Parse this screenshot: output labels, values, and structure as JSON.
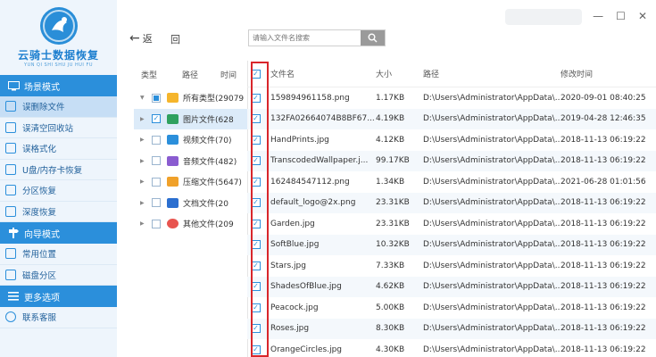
{
  "app": {
    "name": "云骑士数据恢复",
    "subtitle": "YUN QI SHI SHU JU HUI FU"
  },
  "sidebar": {
    "sections": [
      {
        "title": "场景模式",
        "items": [
          "误删除文件",
          "误清空回收站",
          "误格式化",
          "U盘/内存卡恢复",
          "分区恢复",
          "深度恢复"
        ]
      },
      {
        "title": "向导模式",
        "items": [
          "常用位置",
          "磁盘分区"
        ]
      },
      {
        "title": "更多选项",
        "items": [
          "联系客服"
        ]
      }
    ]
  },
  "toolbar": {
    "back_label": "返",
    "forward_label": "回",
    "search_placeholder": "请输入文件名搜索"
  },
  "tree": {
    "headers": [
      "类型",
      "路径",
      "时间"
    ],
    "items": [
      {
        "label": "所有类型(29079",
        "color": "#f5b52c"
      },
      {
        "label": "图片文件(628",
        "color": "#2fa15f"
      },
      {
        "label": "视频文件(70)",
        "color": "#2b8fdb"
      },
      {
        "label": "音频文件(482)",
        "color": "#8a5cd0"
      },
      {
        "label": "压缩文件(5647)",
        "color": "#f0a12a"
      },
      {
        "label": "文档文件(20",
        "color": "#2b6fd0"
      },
      {
        "label": "其他文件(209",
        "color": "#e8544f"
      }
    ]
  },
  "table": {
    "headers": [
      "文件名",
      "大小",
      "路径",
      "修改时间"
    ],
    "rows": [
      [
        "159894961158.png",
        "1.17KB",
        "D:\\Users\\Administrator\\AppData\\...",
        "2020-09-01 08:40:25"
      ],
      [
        "132FA02664074B8BF67...",
        "4.19KB",
        "D:\\Users\\Administrator\\AppData\\...",
        "2019-04-28 12:46:35"
      ],
      [
        "HandPrints.jpg",
        "4.12KB",
        "D:\\Users\\Administrator\\AppData\\...",
        "2018-11-13 06:19:22"
      ],
      [
        "TranscodedWallpaper.j...",
        "99.17KB",
        "D:\\Users\\Administrator\\AppData\\...",
        "2018-11-13 06:19:22"
      ],
      [
        "162484547112.png",
        "1.34KB",
        "D:\\Users\\Administrator\\AppData\\...",
        "2021-06-28 01:01:56"
      ],
      [
        "default_logo@2x.png",
        "23.31KB",
        "D:\\Users\\Administrator\\AppData\\...",
        "2018-11-13 06:19:22"
      ],
      [
        "Garden.jpg",
        "23.31KB",
        "D:\\Users\\Administrator\\AppData\\...",
        "2018-11-13 06:19:22"
      ],
      [
        "SoftBlue.jpg",
        "10.32KB",
        "D:\\Users\\Administrator\\AppData\\...",
        "2018-11-13 06:19:22"
      ],
      [
        "Stars.jpg",
        "7.33KB",
        "D:\\Users\\Administrator\\AppData\\...",
        "2018-11-13 06:19:22"
      ],
      [
        "ShadesOfBlue.jpg",
        "4.62KB",
        "D:\\Users\\Administrator\\AppData\\...",
        "2018-11-13 06:19:22"
      ],
      [
        "Peacock.jpg",
        "5.00KB",
        "D:\\Users\\Administrator\\AppData\\...",
        "2018-11-13 06:19:22"
      ],
      [
        "Roses.jpg",
        "8.30KB",
        "D:\\Users\\Administrator\\AppData\\...",
        "2018-11-13 06:19:22"
      ],
      [
        "OrangeCircles.jpg",
        "4.30KB",
        "D:\\Users\\Administrator\\AppData\\...",
        "2018-11-13 06:19:22"
      ]
    ]
  },
  "colors": {
    "accent": "#2b8fdb",
    "highlight_box": "#d9262b"
  }
}
